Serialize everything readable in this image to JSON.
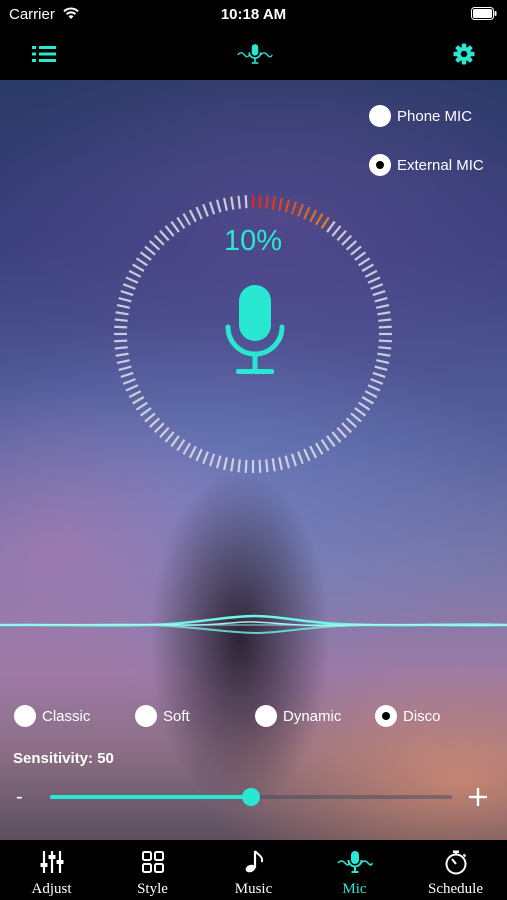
{
  "status_bar": {
    "carrier": "Carrier",
    "time": "10:18 AM"
  },
  "nav": {
    "left_icon": "list-icon",
    "center_icon": "mic-wave-icon",
    "right_icon": "gear-icon"
  },
  "mic_source": {
    "options": [
      {
        "label": "Phone MIC",
        "selected": false
      },
      {
        "label": "External MIC",
        "selected": true
      }
    ]
  },
  "level": {
    "percent_text": "10%",
    "value": 0.1
  },
  "styles": {
    "options": [
      {
        "label": "Classic",
        "selected": false
      },
      {
        "label": "Soft",
        "selected": false
      },
      {
        "label": "Dynamic",
        "selected": false
      },
      {
        "label": "Disco",
        "selected": true
      }
    ]
  },
  "sensitivity": {
    "label": "Sensitivity: 50",
    "value": 50,
    "min": 0,
    "max": 100,
    "minus": "-",
    "plus_icon": "plus-icon"
  },
  "tabs": [
    {
      "label": "Adjust",
      "icon": "sliders-icon",
      "active": false
    },
    {
      "label": "Style",
      "icon": "grid-icon",
      "active": false
    },
    {
      "label": "Music",
      "icon": "music-note-icon",
      "active": false
    },
    {
      "label": "Mic",
      "icon": "mic-wave-icon",
      "active": true
    },
    {
      "label": "Schedule",
      "icon": "stopwatch-icon",
      "active": false
    }
  ],
  "colors": {
    "accent": "#28e8d2",
    "level_red": "#e02020",
    "level_orange": "#e08a20"
  }
}
